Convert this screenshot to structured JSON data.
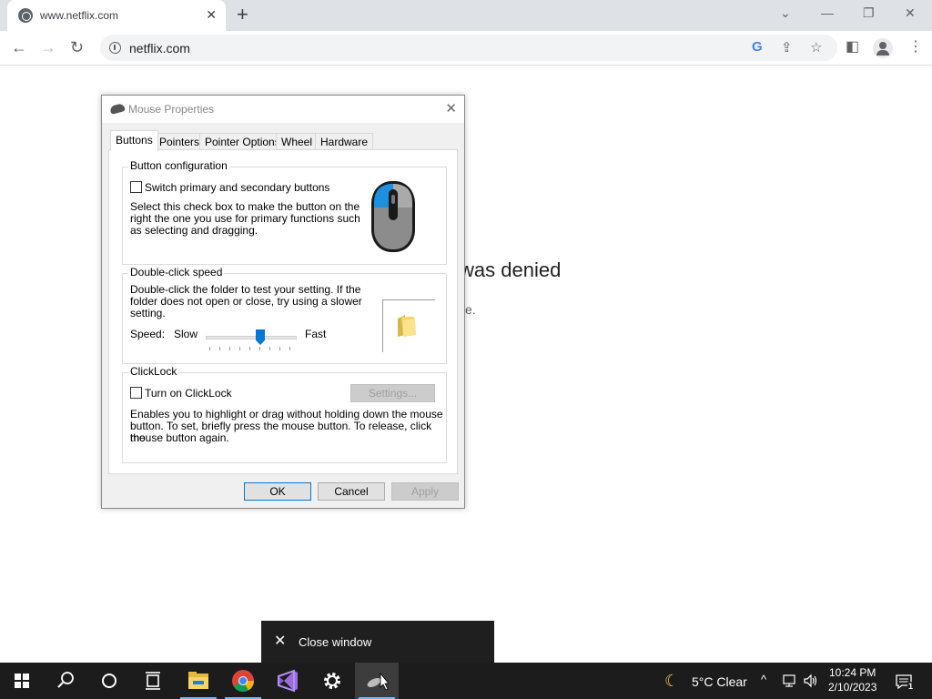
{
  "browser": {
    "tab_title": "www.netflix.com",
    "tab_close": "✕",
    "new_tab": "+",
    "url": "netflix.com",
    "win_min": "—",
    "win_restore": "❐",
    "win_close": "✕",
    "tab_search": "⌄"
  },
  "page": {
    "heading": "was denied",
    "sub": "e."
  },
  "dialog": {
    "title": "Mouse Properties",
    "close": "✕",
    "tabs": [
      "Buttons",
      "Pointers",
      "Pointer Options",
      "Wheel",
      "Hardware"
    ],
    "button_config": {
      "label": "Button configuration",
      "checkbox_label": "Switch primary and secondary buttons",
      "desc_line1": "Select this check box to make the button on the",
      "desc_line2": "right the one you use for primary functions such",
      "desc_line3": "as selecting and dragging."
    },
    "double_click": {
      "label": "Double-click speed",
      "desc_line1": "Double-click the folder to test your setting. If the",
      "desc_line2": "folder does not open or close, try using a slower",
      "desc_line3": "setting.",
      "speed_label": "Speed:",
      "slow": "Slow",
      "fast": "Fast",
      "speed_value": 0.6
    },
    "clicklock": {
      "label": "ClickLock",
      "checkbox_label": "Turn on ClickLock",
      "settings_button": "Settings...",
      "desc_line1": "Enables you to highlight or drag without holding down the mouse",
      "desc_line2": "button. To set, briefly press the mouse button. To release, click the",
      "desc_line3": "mouse button again."
    },
    "ok": "OK",
    "cancel": "Cancel",
    "apply": "Apply"
  },
  "tooltip": {
    "icon": "✕",
    "text": "Close window"
  },
  "taskbar": {
    "weather": "5°C  Clear",
    "time": "10:24 PM",
    "date": "2/10/2023",
    "notification_count": "1"
  }
}
